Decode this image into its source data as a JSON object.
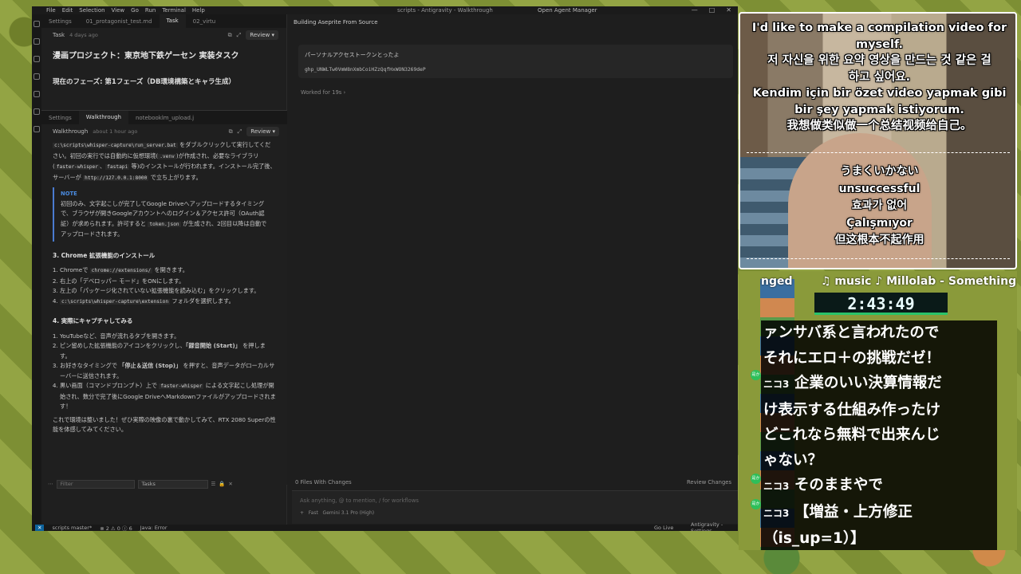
{
  "menubar": {
    "items": [
      "File",
      "Edit",
      "Selection",
      "View",
      "Go",
      "Run",
      "Terminal",
      "Help"
    ],
    "title": "scripts - Antigravity - Walkthrough",
    "agent_manager": "Open Agent Manager"
  },
  "left": {
    "tabs": [
      "Settings",
      "01_protagonist_test.md",
      "Task",
      "02_virtu"
    ],
    "task_header": {
      "label": "Task",
      "time": "4 days ago",
      "review": "Review"
    },
    "task_title": "漫画プロジェクト：東京地下鉄ゲーセン 実装タスク",
    "phase": "現在のフェーズ: 第1フェーズ（DB環境構築とキャラ生成）",
    "tabs2": [
      "Settings",
      "Walkthrough",
      "notebooklm_upload.j"
    ],
    "walk_header": {
      "label": "Walkthrough",
      "time": "about 1 hour ago",
      "review": "Review"
    },
    "doc": {
      "p1a": "c:\\scripts\\whisper-capture\\run_server.bat",
      "p1b": " をダブルクリックして実行してください。初回の実行では自動的に仮想環境(",
      "p1c": ".venv",
      "p1d": ")が作成され、必要なライブラリ(",
      "p1e": "faster-whisper",
      "p1f": "、",
      "p1g": "fastapi",
      "p1h": " 等)のインストールが行われます。インストール完了後、サーバーが ",
      "p1i": "http://127.0.0.1:8000",
      "p1j": " で立ち上がります。",
      "note_title": "NOTE",
      "note_a": "初回のみ、文字起こしが完了してGoogle Driveへアップロードするタイミングで、ブラウザが開きGoogleアカウントへのログイン＆アクセス許可（OAuth認証）が求められます。許可すると ",
      "note_code": "token.json",
      "note_b": " が生成され、2回目以降は自動でアップロードされます。",
      "h3": "3. Chrome 拡張機能のインストール",
      "s3_1a": "Chromeで ",
      "s3_1code": "chrome://extensions/",
      "s3_1b": " を開きます。",
      "s3_2": "右上の「デベロッパー モード」をONにします。",
      "s3_3": "左上の「パッケージ化されていない拡張機能を読み込む」をクリックします。",
      "s3_4code": "c:\\scripts\\whisper-capture\\extension",
      "s3_4b": " フォルダを選択します。",
      "h4": "4. 実際にキャプチャしてみる",
      "s4_1": "YouTubeなど、音声が流れるタブを開きます。",
      "s4_2a": "ピン留めした拡張機能のアイコンをクリックし、",
      "s4_2b": "「録音開始 (Start)」",
      "s4_2c": " を押します。",
      "s4_3a": "お好きなタイミングで ",
      "s4_3b": "「停止＆送信 (Stop)」",
      "s4_3c": " を押すと、音声データがローカルサーバーに送信されます。",
      "s4_4a": "黒い画面（コマンドプロンプト）上で ",
      "s4_4code": "faster-whisper",
      "s4_4b": " による文字起こし処理が開始され、数分で完了後にGoogle DriveへMarkdownファイルがアップロードされます！",
      "outro": "これで環境は整いました！ぜひ実際の映像の裏で動かしてみて、RTX 2080 Superの性能を体感してみてください。"
    },
    "filter": {
      "placeholder": "Filter",
      "tasks": "Tasks"
    }
  },
  "main": {
    "title": "Building Aseprite From Source",
    "msg": "パーソナルアクセストークンとったよ",
    "token": "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",
    "worked": "Worked for 19s",
    "files": "0 Files With Changes",
    "review_changes": "Review Changes",
    "input_placeholder": "Ask anything, @ to mention, / for workflows",
    "mode": "Fast",
    "model": "Gemini 3.1 Pro (High)"
  },
  "status": {
    "branch": "scripts  master*",
    "problems": "⊗ 2 ⚠ 0 ⓘ 6",
    "java": "Java: Error",
    "golive": "Go Live",
    "settings": "Antigravity - Settings"
  },
  "captions": {
    "top": [
      "I'd like to make a compilation video for",
      "myself.",
      "저 자신을 위한 요약 영상을 만드는 것 같은 걸",
      "하고 싶어요.",
      "Kendim için bir özet video yapmak gibi",
      "bir şey yapmak istiyorum.",
      "我想做类似做一个总结视频给自己。"
    ],
    "bottom": [
      "うまくいかない",
      "unsuccessful",
      "효과가 없어",
      "Çalışmıyor",
      "但这根本不起作用"
    ]
  },
  "overlay": {
    "changed": "nged",
    "music": "♫ music ♪ Millolab - Something",
    "timer": "2:43:49",
    "chat_lines": [
      "ァンサバ系と言われたので",
      "それにエロ＋の挑戦だゼ！",
      "企業のいい決算情報だ",
      "け表示する仕組み作ったけ",
      "どこれなら無料で出来んじ",
      "ゃない？",
      "そのままやで",
      "【増益・上方修正",
      "（is_up=1）】"
    ],
    "user": "ニコ3",
    "badge": "是か"
  }
}
